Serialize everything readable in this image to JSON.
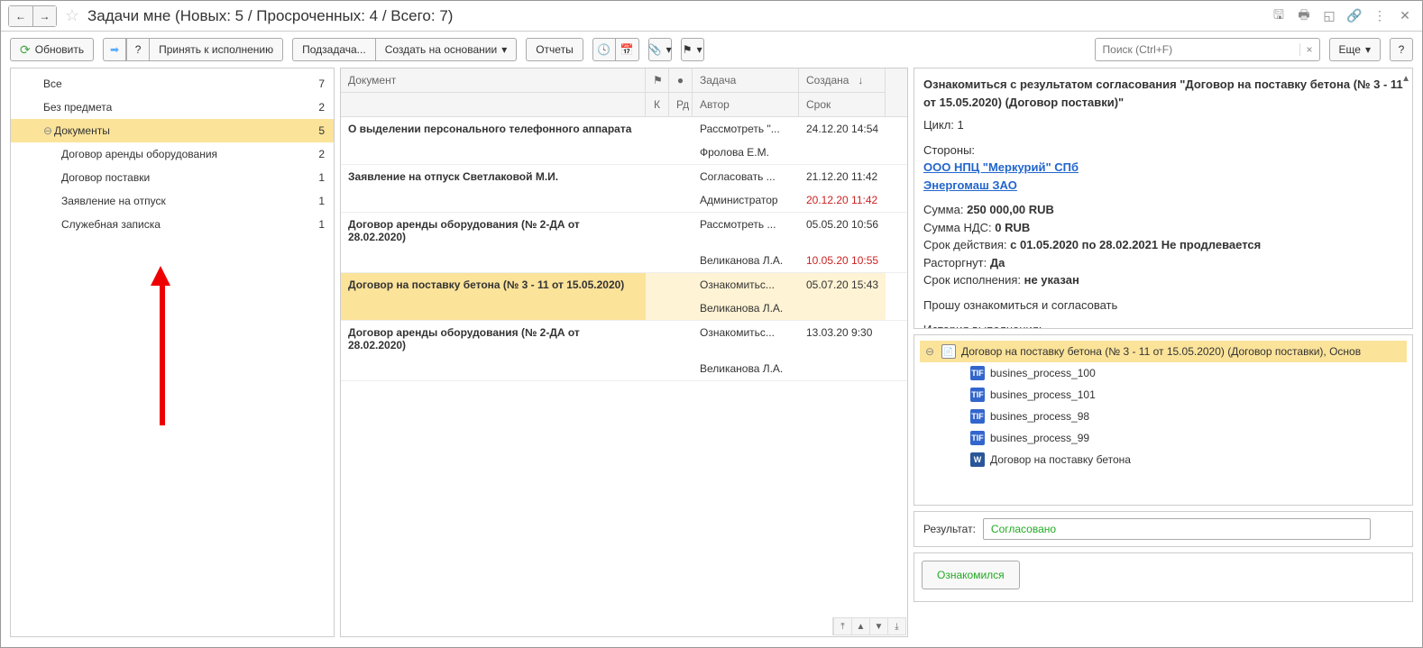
{
  "title": "Задачи мне (Новых: 5 / Просроченных: 4 / Всего: 7)",
  "toolbar": {
    "refresh": "Обновить",
    "accept": "Принять к исполнению",
    "subtask": "Подзадача...",
    "create_based": "Создать на основании",
    "reports": "Отчеты",
    "search_placeholder": "Поиск (Ctrl+F)",
    "more": "Еще"
  },
  "tree": [
    {
      "label": "Все",
      "count": "7",
      "indent": 1
    },
    {
      "label": "Без предмета",
      "count": "2",
      "indent": 1
    },
    {
      "label": "Документы",
      "count": "5",
      "indent": 1,
      "expandable": true,
      "selected": true
    },
    {
      "label": "Договор аренды оборудования",
      "count": "2",
      "indent": 2
    },
    {
      "label": "Договор поставки",
      "count": "1",
      "indent": 2
    },
    {
      "label": "Заявление на отпуск",
      "count": "1",
      "indent": 2
    },
    {
      "label": "Служебная записка",
      "count": "1",
      "indent": 2
    }
  ],
  "grid": {
    "headers": {
      "doc": "Документ",
      "task": "Задача",
      "created": "Создана",
      "k": "К",
      "rd": "Рд",
      "author": "Автор",
      "deadline": "Срок"
    },
    "rows": [
      {
        "doc": "О выделении персонального телефонного аппарата",
        "task": "Рассмотреть \"...",
        "created": "24.12.20 14:54",
        "author": "Фролова Е.М.",
        "deadline": ""
      },
      {
        "doc": "Заявление на отпуск Светлаковой М.И.",
        "task": "Согласовать ...",
        "created": "21.12.20 11:42",
        "author": "Администратор",
        "deadline": "20.12.20 11:42",
        "dl_red": true
      },
      {
        "doc": "Договор аренды оборудования (№ 2-ДА от 28.02.2020)",
        "task": "Рассмотреть ...",
        "created": "05.05.20 10:56",
        "author": "Великанова Л.А.",
        "deadline": "10.05.20 10:55",
        "dl_red": true
      },
      {
        "doc": "Договор на поставку бетона (№ 3 - 11 от 15.05.2020)",
        "task": "Ознакомитьс...",
        "created": "05.07.20 15:43",
        "author": "Великанова Л.А.",
        "deadline": "",
        "selected": true
      },
      {
        "doc": "Договор аренды оборудования (№ 2-ДА от 28.02.2020)",
        "task": "Ознакомитьс...",
        "created": "13.03.20 9:30",
        "author": "Великанова Л.А.",
        "deadline": ""
      }
    ]
  },
  "info": {
    "title": "Ознакомиться с результатом согласования \"Договор на поставку бетона (№ 3 - 11 от 15.05.2020) (Договор поставки)\"",
    "cycle_lbl": "Цикл:",
    "cycle": "1",
    "sides_lbl": "Стороны:",
    "side1": "ООО НПЦ \"Меркурий\" СПб",
    "side2": "Энергомаш ЗАО",
    "sum_lbl": "Сумма:",
    "sum": "250 000,00 RUB",
    "sum_nds_lbl": "Сумма НДС:",
    "sum_nds": "0 RUB",
    "period_lbl": "Срок действия:",
    "period": "с 01.05.2020 по 28.02.2021 Не продлевается",
    "terminated_lbl": "Расторгнут:",
    "terminated": "Да",
    "exec_lbl": "Срок исполнения:",
    "exec": "не указан",
    "request": "Прошу ознакомиться и согласовать",
    "history_lbl": "История выполнения:",
    "dash": "--------------------------------------------"
  },
  "attachments": {
    "root": "Договор на поставку бетона (№ 3 - 11 от 15.05.2020) (Договор поставки), Основ",
    "items": [
      {
        "name": "busines_process_100",
        "type": "tif"
      },
      {
        "name": "busines_process_101",
        "type": "tif"
      },
      {
        "name": "busines_process_98",
        "type": "tif"
      },
      {
        "name": "busines_process_99",
        "type": "tif"
      },
      {
        "name": "Договор на поставку бетона",
        "type": "w"
      }
    ]
  },
  "result": {
    "label": "Результат:",
    "value": "Согласовано"
  },
  "action": {
    "label": "Ознакомился"
  }
}
